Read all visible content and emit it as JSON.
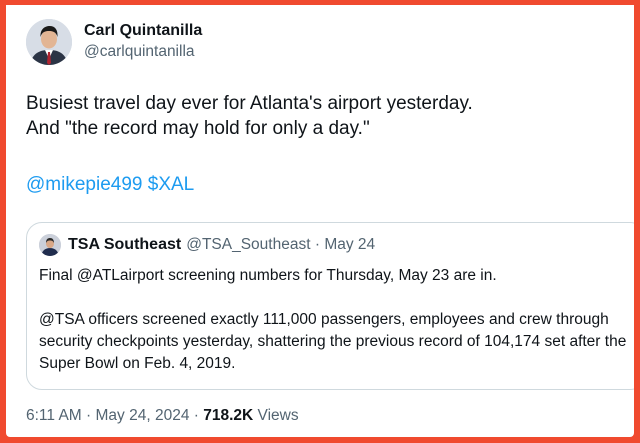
{
  "tweet": {
    "author": {
      "display_name": "Carl Quintanilla",
      "handle": "@carlquintanilla"
    },
    "text_lines": [
      "Busiest travel day ever for Atlanta's airport yesterday.",
      "And \"the record may hold for only a day.\""
    ],
    "mentions": [
      "@mikepie499",
      "$XAL"
    ],
    "quoted": {
      "display_name": "TSA Southeast",
      "handle": "@TSA_Southeast",
      "separator": "·",
      "date": "May 24",
      "paragraphs": [
        "Final @ATLairport screening numbers for Thursday, May 23 are in.",
        "@TSA officers screened exactly 111,000 passengers, employees and crew through security checkpoints yesterday, shattering the previous record of 104,174 set after the Super Bowl on Feb. 4, 2019."
      ]
    },
    "footer": {
      "time": "6:11 AM",
      "separator": "·",
      "date": "May 24, 2024",
      "views_count": "718.2K",
      "views_label": "Views"
    }
  },
  "colors": {
    "background": "#f04a2f",
    "link": "#1d9bf0",
    "text": "#0f1419",
    "muted": "#536471",
    "border": "#cfd9de"
  },
  "icons": {
    "author_avatar": "avatar-photo",
    "quoted_avatar": "avatar-photo"
  }
}
